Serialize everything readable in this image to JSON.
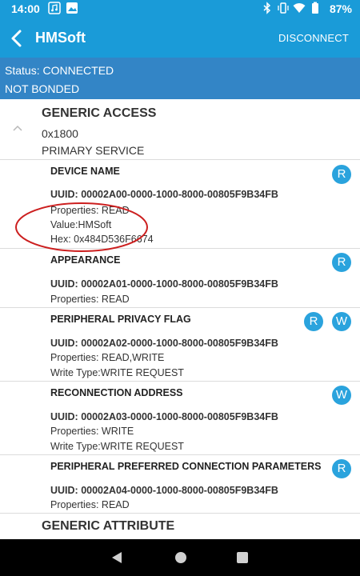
{
  "status_bar": {
    "time": "14:00",
    "battery": "87%",
    "icons": [
      "music-note-icon",
      "image-icon",
      "bluetooth-icon",
      "vibrate-icon",
      "wifi-icon",
      "battery-icon"
    ]
  },
  "app_bar": {
    "title": "HMSoft",
    "action": "DISCONNECT"
  },
  "connection": {
    "status": "Status: CONNECTED",
    "bond": "NOT BONDED"
  },
  "services": [
    {
      "name": "GENERIC ACCESS",
      "uuid": "0x1800",
      "type": "PRIMARY SERVICE",
      "characteristics": [
        {
          "name": "DEVICE NAME",
          "uuid": "UUID: 00002A00-0000-1000-8000-00805F9B34FB",
          "properties": "Properties: READ",
          "value": "Value:HMSoft",
          "hex": "Hex: 0x484D536F6674",
          "buttons": [
            "R"
          ]
        },
        {
          "name": "APPEARANCE",
          "uuid": "UUID: 00002A01-0000-1000-8000-00805F9B34FB",
          "properties": "Properties: READ",
          "buttons": [
            "R"
          ]
        },
        {
          "name": "PERIPHERAL PRIVACY FLAG",
          "uuid": "UUID: 00002A02-0000-1000-8000-00805F9B34FB",
          "properties": "Properties: READ,WRITE",
          "write_type": "Write Type:WRITE REQUEST",
          "buttons": [
            "R",
            "W"
          ]
        },
        {
          "name": "RECONNECTION ADDRESS",
          "uuid": "UUID: 00002A03-0000-1000-8000-00805F9B34FB",
          "properties": "Properties: WRITE",
          "write_type": "Write Type:WRITE REQUEST",
          "buttons": [
            "W"
          ]
        },
        {
          "name": "PERIPHERAL PREFERRED CONNECTION PARAMETERS",
          "uuid": "UUID: 00002A04-0000-1000-8000-00805F9B34FB",
          "properties": "Properties: READ",
          "buttons": [
            "R"
          ]
        }
      ]
    },
    {
      "name": "GENERIC ATTRIBUTE"
    }
  ],
  "colors": {
    "app_bar": "#1a9bd8",
    "connection_bar": "#3385c6",
    "action_button": "#2aa3dd",
    "annotation": "#cc1f1f"
  }
}
